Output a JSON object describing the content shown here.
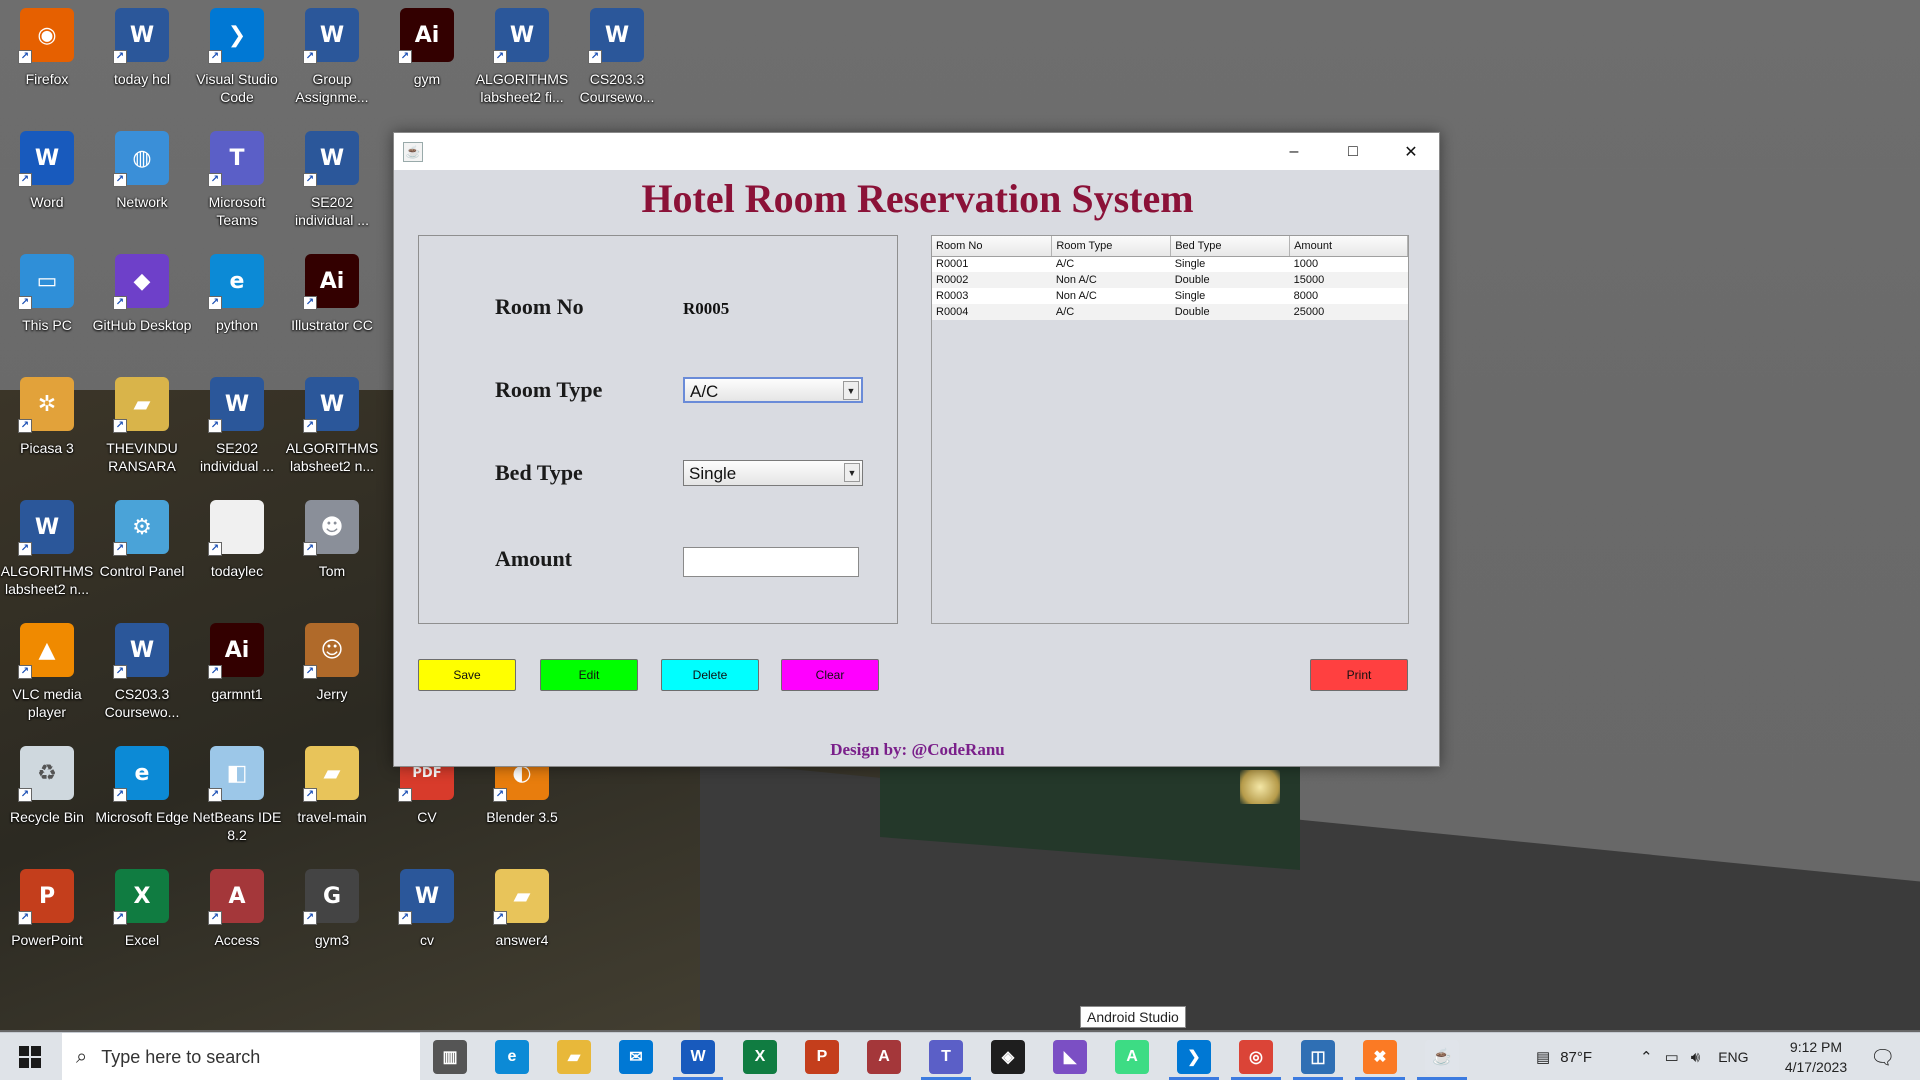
{
  "desktop": {
    "icons": [
      {
        "label": "Firefox",
        "name": "firefox-icon"
      },
      {
        "label": "today hcl",
        "name": "word-doc-icon"
      },
      {
        "label": "Visual Studio Code",
        "name": "vscode-icon"
      },
      {
        "label": "Group Assignme...",
        "name": "word-doc-icon"
      },
      {
        "label": "gym",
        "name": "illustrator-file-icon"
      },
      {
        "label": "ALGORITHMS labsheet2 fi...",
        "name": "word-doc-icon"
      },
      {
        "label": "CS203.3 Coursewo...",
        "name": "word-doc-icon"
      },
      {
        "label": "Word",
        "name": "word-app-icon"
      },
      {
        "label": "Network",
        "name": "network-icon"
      },
      {
        "label": "Microsoft Teams",
        "name": "teams-icon"
      },
      {
        "label": "SE202 individual ...",
        "name": "word-doc-icon"
      },
      {
        "label": "This PC",
        "name": "this-pc-icon"
      },
      {
        "label": "GitHub Desktop",
        "name": "github-desktop-icon"
      },
      {
        "label": "python",
        "name": "edge-shortcut-icon"
      },
      {
        "label": "Illustrator CC",
        "name": "illustrator-app-icon"
      },
      {
        "label": "Picasa 3",
        "name": "picasa-icon"
      },
      {
        "label": "THEVINDU RANSARA",
        "name": "user-folder-icon"
      },
      {
        "label": "SE202 individual ...",
        "name": "word-doc-icon"
      },
      {
        "label": "ALGORITHMS labsheet2 n...",
        "name": "word-doc-icon"
      },
      {
        "label": "ALGORITHMS labsheet2 n...",
        "name": "word-doc-icon"
      },
      {
        "label": "Control Panel",
        "name": "control-panel-icon"
      },
      {
        "label": "todaylec",
        "name": "blank-file-icon"
      },
      {
        "label": "Tom",
        "name": "tom-icon"
      },
      {
        "label": "VLC media player",
        "name": "vlc-icon"
      },
      {
        "label": "CS203.3 Coursewo...",
        "name": "word-doc-icon"
      },
      {
        "label": "garmnt1",
        "name": "illustrator-file-icon"
      },
      {
        "label": "Jerry",
        "name": "jerry-icon"
      },
      {
        "label": "Recycle Bin",
        "name": "recycle-bin-icon"
      },
      {
        "label": "Microsoft Edge",
        "name": "edge-icon"
      },
      {
        "label": "NetBeans IDE 8.2",
        "name": "netbeans-icon"
      },
      {
        "label": "travel-main",
        "name": "folder-icon"
      },
      {
        "label": "CV",
        "name": "pdf-icon"
      },
      {
        "label": "Blender 3.5",
        "name": "blender-icon"
      },
      {
        "label": "PowerPoint",
        "name": "powerpoint-icon"
      },
      {
        "label": "Excel",
        "name": "excel-icon"
      },
      {
        "label": "Access",
        "name": "access-icon"
      },
      {
        "label": "gym3",
        "name": "gym-logo-icon"
      },
      {
        "label": "cv",
        "name": "word-doc-icon"
      },
      {
        "label": "answer4",
        "name": "folder-icon"
      }
    ]
  },
  "window": {
    "title": "Hotel Room Reservation System",
    "controls": {
      "minimize": "–",
      "maximize": "□",
      "close": "✕"
    },
    "form": {
      "room_no_label": "Room No",
      "room_no_value": "R0005",
      "room_type_label": "Room Type",
      "room_type_value": "A/C",
      "bed_type_label": "Bed Type",
      "bed_type_value": "Single",
      "amount_label": "Amount",
      "amount_value": ""
    },
    "table": {
      "headers": [
        "Room No",
        "Room Type",
        "Bed Type",
        "Amount"
      ],
      "rows": [
        [
          "R0001",
          "A/C",
          "Single",
          "1000"
        ],
        [
          "R0002",
          "Non A/C",
          "Double",
          "15000"
        ],
        [
          "R0003",
          "Non A/C",
          "Single",
          "8000"
        ],
        [
          "R0004",
          "A/C",
          "Double",
          "25000"
        ]
      ]
    },
    "buttons": {
      "save": "Save",
      "edit": "Edit",
      "delete": "Delete",
      "clear": "Clear",
      "print": "Print"
    },
    "footer": "Design by: @CodeRanu",
    "colors": {
      "title": "#8b1238",
      "save": "#ffff00",
      "edit": "#00ff00",
      "delete": "#00ffff",
      "clear": "#ff00ff",
      "print": "#ff4040",
      "footer": "#7a1f8a"
    }
  },
  "tooltip": "Android Studio",
  "taskbar": {
    "search_placeholder": "Type here to search",
    "apps": [
      "task-view-icon",
      "edge-icon",
      "file-explorer-icon",
      "mail-icon",
      "word-icon",
      "excel-icon",
      "powerpoint-icon",
      "access-icon",
      "teams-icon",
      "figma-icon",
      "visual-studio-icon",
      "android-studio-icon",
      "vscode-icon",
      "chrome-icon",
      "virtualbox-icon",
      "xampp-icon",
      "java-icon"
    ],
    "weather": "87°F",
    "language": "ENG",
    "time": "9:12 PM",
    "date": "4/17/2023"
  }
}
